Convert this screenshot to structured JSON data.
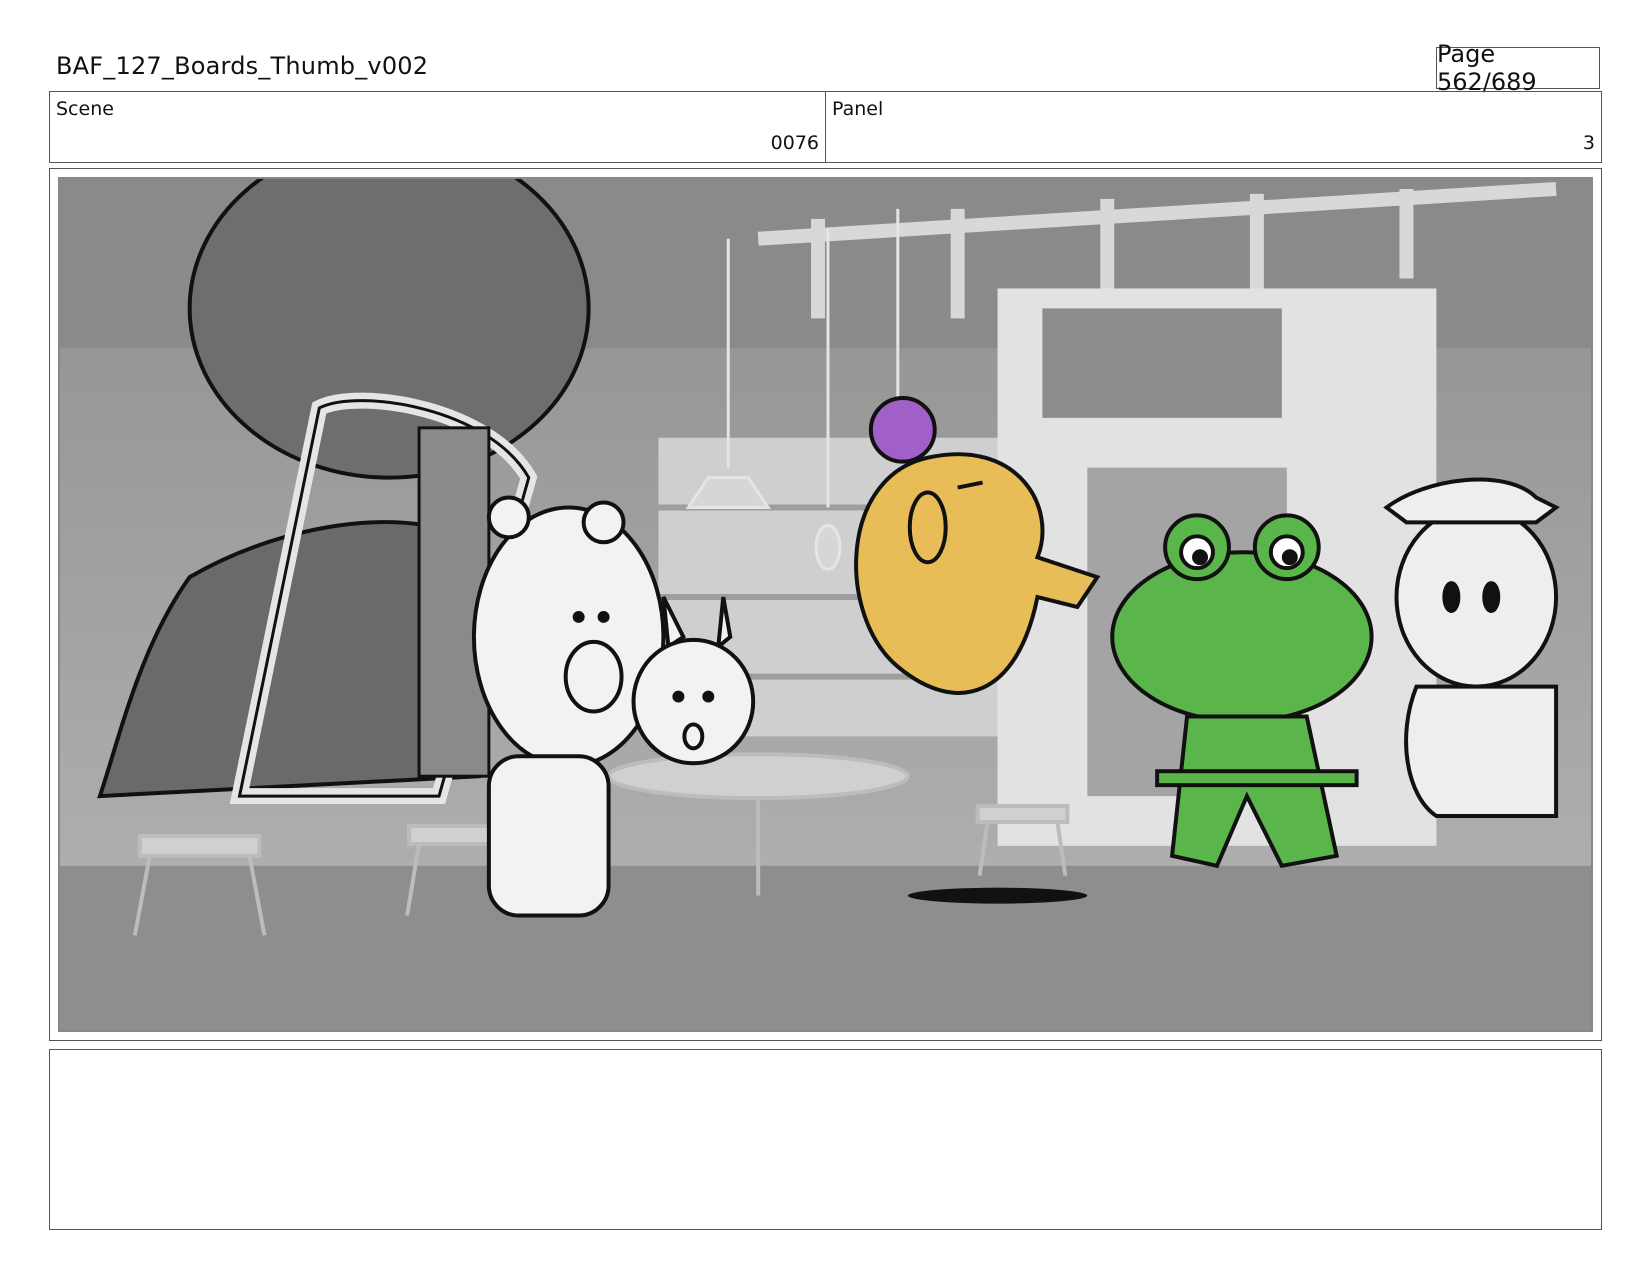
{
  "header": {
    "title": "BAF_127_Boards_Thumb_v002",
    "page": "Page 562/689"
  },
  "info": {
    "scene_label": "Scene",
    "scene_value": "0076",
    "panel_label": "Panel",
    "panel_value": "3"
  },
  "panel": {
    "characters": [
      "bear",
      "rabbit",
      "chick",
      "frog",
      "boy-with-cap"
    ],
    "colors": {
      "background": "#9b9b9b",
      "chick": "#e8bd57",
      "chick_ball": "#a060c8",
      "frog": "#5ab64a"
    }
  },
  "notes": {
    "text": ""
  }
}
